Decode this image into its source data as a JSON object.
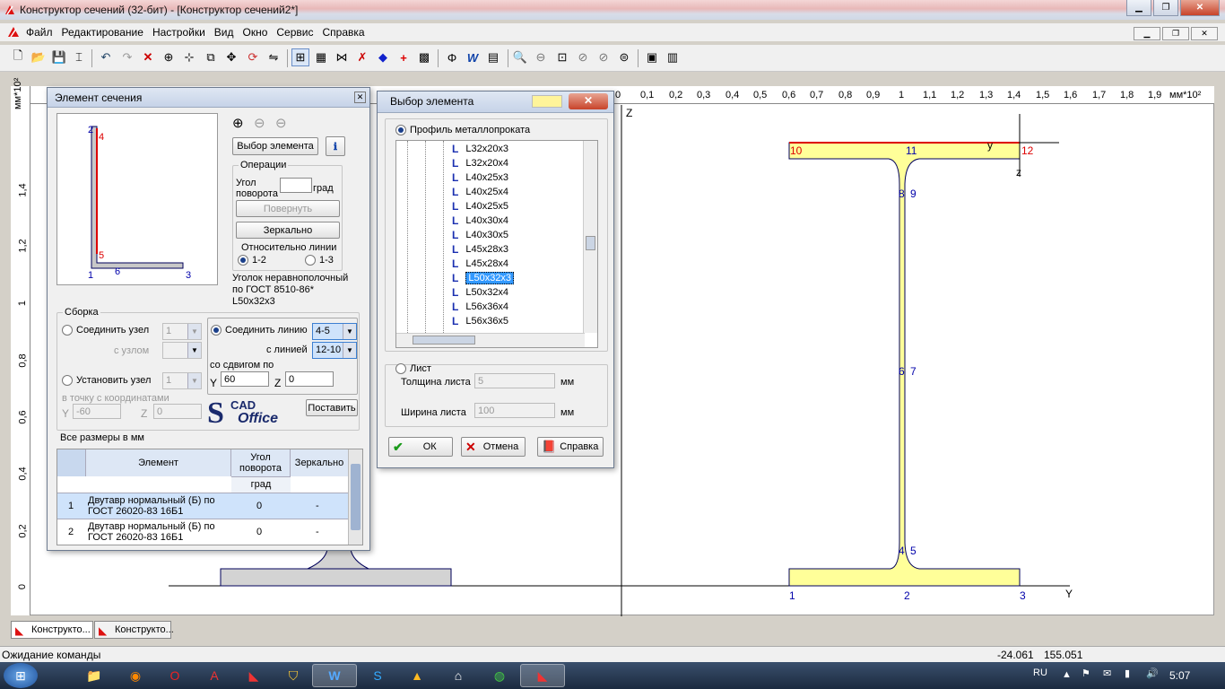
{
  "window": {
    "title": "Конструктор сечений (32-бит) - [Конструктор сечений2*]"
  },
  "menu": [
    "Файл",
    "Редактирование",
    "Настройки",
    "Вид",
    "Окно",
    "Сервис",
    "Справка"
  ],
  "ruler": {
    "unit": "мм*10²",
    "top_ticks": [
      "0",
      "0,1",
      "0,2",
      "0,3",
      "0,4",
      "0,5",
      "0,6",
      "0,7",
      "0,8",
      "0,9",
      "1",
      "1,1",
      "1,2",
      "1,3",
      "1,4",
      "1,5",
      "1,6",
      "1,7",
      "1,8",
      "1,9"
    ],
    "left_ticks": [
      "1,4",
      "1,2",
      "1",
      "0,8",
      "0,6",
      "0,4",
      "0,2",
      "0"
    ]
  },
  "drawing": {
    "axis_z": "Z",
    "axis_y": "Y",
    "local_y": "y",
    "local_z": "z",
    "node_labels": [
      "1",
      "2",
      "3",
      "4",
      "5",
      "6",
      "7",
      "8",
      "9",
      "10",
      "11",
      "12"
    ]
  },
  "element_dialog": {
    "title": "Элемент сечения",
    "preview_labels": [
      "2",
      "4",
      "5",
      "1",
      "6",
      "3"
    ],
    "choose_button": "Выбор элемента",
    "operations": "Операции",
    "rotation_angle_label": "Угол поворота",
    "rotation_angle_value": "",
    "degree": "град",
    "rotate_button": "Повернуть",
    "mirror_button": "Зеркально",
    "relative_to_line": "Относительно линии",
    "line_12": "1-2",
    "line_13": "1-3",
    "element_description": "Уголок неравнополочный по ГОСТ 8510-86* L50x32x3",
    "assembly": "Сборка",
    "join_node": "Соединить узел",
    "join_node_value": "1",
    "with_node": "с узлом",
    "join_line": "Соединить линию",
    "join_line_value": "4-5",
    "with_line": "с линией",
    "with_line_value": "12-10",
    "with_offset": "со сдвигом по",
    "offset_y_label": "Y",
    "offset_y": "60",
    "offset_z_label": "Z",
    "offset_z": "0",
    "set_node": "Установить узел",
    "set_node_value": "1",
    "to_point": "в точку с координатами",
    "point_y_label": "Y",
    "point_y": "-60",
    "point_z_label": "Z",
    "point_z": "0",
    "logo_text_1": "CAD",
    "logo_text_2": "Office",
    "place_button": "Поставить",
    "units_note": "Все размеры в мм",
    "table": {
      "col_element": "Элемент",
      "col_angle": "Угол поворота",
      "col_angle_unit": "град",
      "col_mirror": "Зеркально",
      "rows": [
        {
          "n": "1",
          "element": "Двутавр нормальный (Б) по ГОСТ 26020-83 16Б1",
          "angle": "0",
          "mirror": "-"
        },
        {
          "n": "2",
          "element": "Двутавр нормальный (Б) по ГОСТ 26020-83 16Б1",
          "angle": "0",
          "mirror": "-"
        }
      ]
    }
  },
  "select_dialog": {
    "title": "Выбор элемента",
    "profile_option": "Профиль металлопроката",
    "items": [
      "L32x20x3",
      "L32x20x4",
      "L40x25x3",
      "L40x25x4",
      "L40x25x5",
      "L40x30x4",
      "L40x30x5",
      "L45x28x3",
      "L45x28x4",
      "L50x32x3",
      "L50x32x4",
      "L56x36x4",
      "L56x36x5"
    ],
    "selected_item": "L50x32x3",
    "sheet_option": "Лист",
    "sheet_thickness_label": "Толщина листа",
    "sheet_thickness": "5",
    "sheet_width_label": "Ширина листа",
    "sheet_width": "100",
    "mm": "мм",
    "ok": "ОК",
    "cancel": "Отмена",
    "help": "Справка"
  },
  "tabs": [
    "Конструкто...",
    "Конструкто..."
  ],
  "status": {
    "text": "Ожидание команды",
    "x": "-24.061",
    "y": "155.051"
  },
  "taskbar": {
    "lang": "RU",
    "time": "5:07"
  }
}
